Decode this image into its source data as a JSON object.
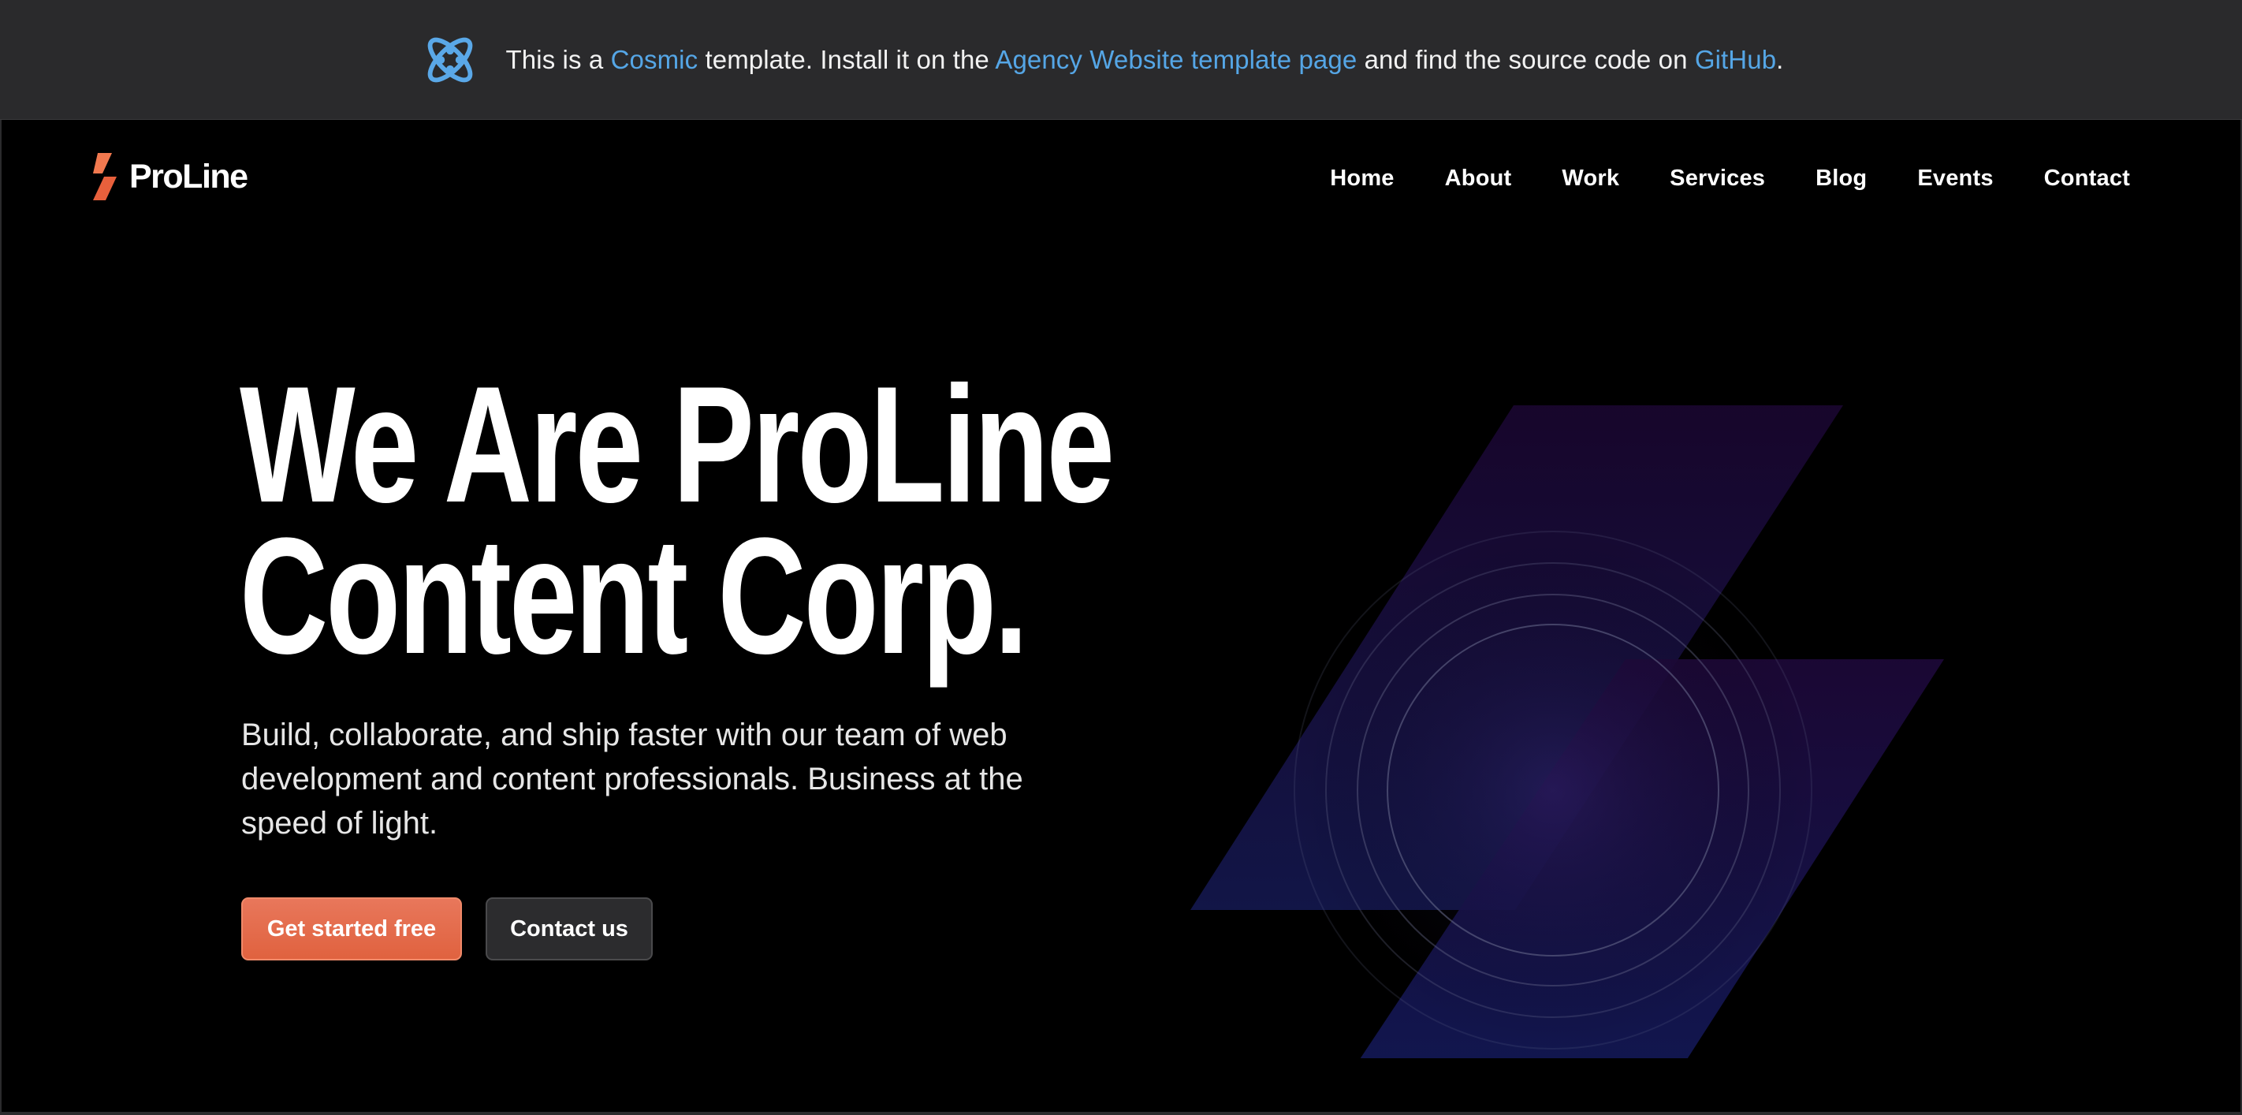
{
  "banner": {
    "prefix": "This is a ",
    "cosmic_link": "Cosmic",
    "middle1": " template. Install it on the ",
    "agency_link": "Agency Website template page",
    "middle2": " and find the source code on ",
    "github_link": "GitHub",
    "suffix": "."
  },
  "brand": {
    "name": "ProLine"
  },
  "nav": {
    "items": [
      "Home",
      "About",
      "Work",
      "Services",
      "Blog",
      "Events",
      "Contact"
    ]
  },
  "hero": {
    "title_line1": "We Are ProLine",
    "title_line2": "Content Corp.",
    "subtitle": "Build, collaborate, and ship faster with our team of web development and content professionals. Business at the speed of light.",
    "primary_button": "Get started free",
    "secondary_button": "Contact us"
  },
  "colors": {
    "accent": "#e8694a",
    "link": "#55a6e6",
    "background": "#000000",
    "banner": "#2a2a2c"
  },
  "icons": [
    "cosmic-logo-icon",
    "proline-bolt-icon",
    "bolt-graphic"
  ]
}
